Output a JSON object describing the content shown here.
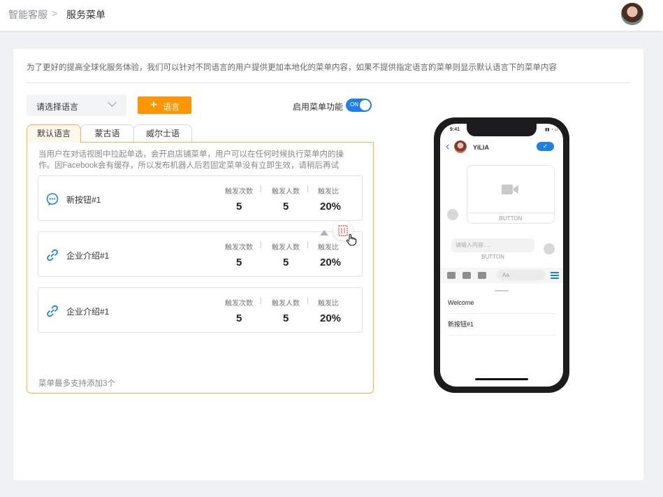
{
  "breadcrumb": {
    "root": "智能客服",
    "separator": ">",
    "current": "服务菜单"
  },
  "description": "为了更好的提高全球化服务体验，我们可以针对不同语言的用户提供更加本地化的菜单内容，如果不提供指定语言的菜单则显示默认语言下的菜单内容",
  "toolbar": {
    "language_select_placeholder": "请选择语言",
    "add_language_label": "语言",
    "enable_menu_label": "启用菜单功能",
    "switch_state": "ON"
  },
  "tabs": [
    {
      "label": "默认语言",
      "active": true
    },
    {
      "label": "蒙古语",
      "active": false
    },
    {
      "label": "威尔士语",
      "active": false
    }
  ],
  "tip": "当用户在对话视图中拉起单选，会开启店铺菜单，用户可以在任何时候执行菜单内的操作。因Facebook会有缓存，所以发布机器人后若固定菜单没有立即生效，请稍后再试",
  "stat_headers": {
    "triggers": "触发次数",
    "users": "触发人数",
    "ratio": "触发比",
    "sep": "|"
  },
  "menu_items": [
    {
      "icon": "chat-bubble-icon",
      "name": "新按钮#1",
      "triggers": "5",
      "users": "5",
      "ratio": "20%"
    },
    {
      "icon": "link-icon",
      "name": "企业介绍#1",
      "triggers": "5",
      "users": "5",
      "ratio": "20%"
    },
    {
      "icon": "link-icon",
      "name": "企业介绍#1",
      "triggers": "5",
      "users": "5",
      "ratio": "20%"
    }
  ],
  "limit_note": "菜单最多支持添加3个",
  "phone": {
    "time": "9:41",
    "contact_name": "YILIA",
    "card_button": "BUTTON",
    "input_placeholder": "请输入内容.....",
    "input_button": "BUTTON",
    "compose_placeholder": "Aa",
    "menu_list": [
      "Welcome",
      "新按钮#1"
    ]
  },
  "colors": {
    "accent": "#ff9500",
    "primary": "#1e7fe6",
    "tab_border": "#f2b24d"
  }
}
